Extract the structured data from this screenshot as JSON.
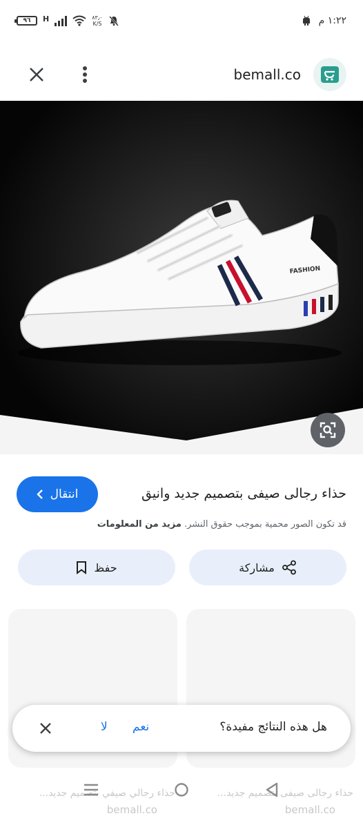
{
  "status_bar": {
    "battery": "٩٦",
    "network_type": "H",
    "speed_value": "٨٣٫٠",
    "speed_unit": "K/S",
    "time": "١:٢٢ م"
  },
  "header": {
    "site_name": "bemall.co",
    "logo_icon": "cart-logo-icon"
  },
  "hero": {
    "brand_text": "FASHION",
    "description": "white sneaker with red and navy stripes on black background"
  },
  "info": {
    "title": "حذاء رجالى صيفى بتصميم جديد وانيق",
    "visit_label": "انتقال",
    "copyright_text": "قد تكون الصور محمية بموجب حقوق النشر.",
    "more_info_label": "مزيد من المعلومات"
  },
  "actions": {
    "share_label": "مشاركة",
    "save_label": "حفظ"
  },
  "related": {
    "right_title": "حذاء رجالى صيفى بتصميم جديد...",
    "right_source": "bemall.co",
    "left_title": "حذاء رجالي صيفي بتصميم جديد...",
    "left_source": "bemall.co"
  },
  "feedback": {
    "question": "هل هذه النتائج مفيدة؟",
    "yes_label": "نعم",
    "no_label": "لا"
  },
  "colors": {
    "accent": "#1a73e8",
    "pill_bg": "#e8effb",
    "logo_teal": "#2a9d8f"
  }
}
